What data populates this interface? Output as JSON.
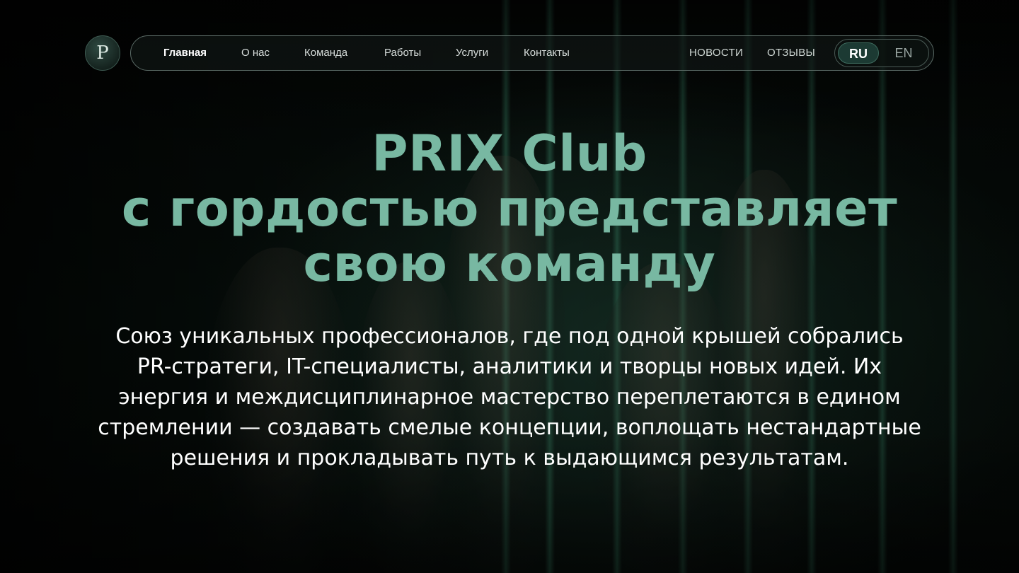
{
  "brand": {
    "logo_letter": "P"
  },
  "nav": {
    "items": [
      {
        "label": "Главная",
        "active": true
      },
      {
        "label": "О нас",
        "active": false
      },
      {
        "label": "Команда",
        "active": false
      },
      {
        "label": "Работы",
        "active": false
      },
      {
        "label": "Услуги",
        "active": false
      },
      {
        "label": "Контакты",
        "active": false
      }
    ],
    "secondary": [
      {
        "label": "НОВОСТИ"
      },
      {
        "label": "ОТЗЫВЫ"
      }
    ],
    "languages": [
      {
        "label": "RU",
        "selected": true
      },
      {
        "label": "EN",
        "selected": false
      }
    ]
  },
  "hero": {
    "title_lines": [
      "PRIX Club",
      "с гордостью представляет",
      "свою команду"
    ],
    "description_lines": [
      "Союз уникальных профессионалов, где под одной крышей собрались",
      "PR-стратеги, IT-специалисты, аналитики и творцы новых идей. Их",
      "энергия и междисциплинарное мастерство переплетаются в едином",
      "стремлении — создавать смелые концепции, воплощать нестандартные",
      "решения и прокладывать путь к выдающимся результатам."
    ]
  },
  "colors": {
    "accent": "#78b8a2",
    "background": "#050807",
    "toggle_active": "#1c3a33"
  }
}
